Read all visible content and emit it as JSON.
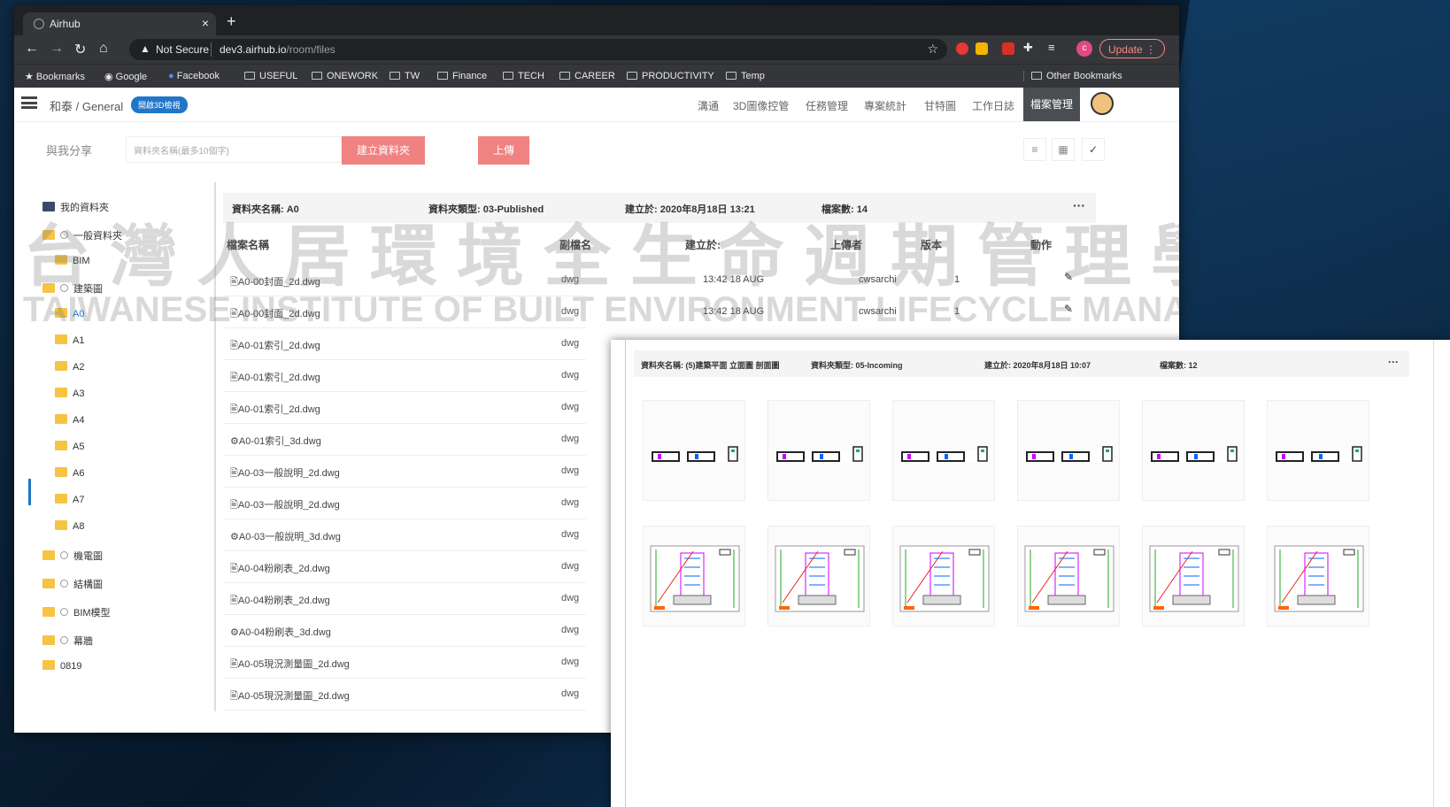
{
  "browser": {
    "tab_title": "Airhub",
    "security": "Not Secure",
    "url_host": "dev3.airhub.io",
    "url_path": "/room/files",
    "update_label": "Update",
    "profile_initial": "c",
    "bookmarks": [
      "Bookmarks",
      "Google",
      "Facebook",
      "USEFUL",
      "ONEWORK",
      "TW",
      "Finance",
      "TECH",
      "CAREER",
      "PRODUCTIVITY",
      "Temp"
    ],
    "other_bookmarks": "Other Bookmarks"
  },
  "app": {
    "breadcrumb": "和泰 / General",
    "pill": "開啟3D檢視",
    "menu": [
      "溝通",
      "3D圖像控管",
      "任務管理",
      "專案統計",
      "甘特圖",
      "工作日誌",
      "檔案管理"
    ],
    "active_menu": "檔案管理"
  },
  "toolbar": {
    "share_label": "與我分享",
    "folder_placeholder": "資料夾名稱(最多10個字)",
    "create_label": "建立資料夾",
    "upload_label": "上傳"
  },
  "tree": {
    "root": "我的資料夾",
    "items": [
      "一般資料夾",
      "BIM",
      "建築圖",
      "A0",
      "A1",
      "A2",
      "A3",
      "A4",
      "A5",
      "A6",
      "A7",
      "A8",
      "機電圖",
      "結構圖",
      "BIM模型",
      "幕牆",
      "0819"
    ]
  },
  "folder": {
    "name": "資料夾名稱: A0",
    "type": "資料夾類型: 03-Published",
    "created": "建立於:  2020年8月18日 13:21",
    "count": "檔案數: 14",
    "more": "···"
  },
  "columns": {
    "name": "檔案名稱",
    "ext": "副檔名",
    "created": "建立於:",
    "uploader": "上傳者",
    "version": "版本",
    "action": "動作"
  },
  "files": [
    {
      "icon": "🖹",
      "name": "A0-00封面_2d.dwg",
      "ext": "dwg",
      "created": "13:42 18 AUG",
      "uploader": "cwsarchi",
      "version": "1"
    },
    {
      "icon": "🖹",
      "name": "A0-00封面_2d.dwg",
      "ext": "dwg",
      "created": "13:42 18 AUG",
      "uploader": "cwsarchi",
      "version": "1"
    },
    {
      "icon": "🖹",
      "name": "A0-01索引_2d.dwg",
      "ext": "dwg"
    },
    {
      "icon": "🖹",
      "name": "A0-01索引_2d.dwg",
      "ext": "dwg"
    },
    {
      "icon": "🖹",
      "name": "A0-01索引_2d.dwg",
      "ext": "dwg"
    },
    {
      "icon": "⚙",
      "name": "A0-01索引_3d.dwg",
      "ext": "dwg"
    },
    {
      "icon": "🖹",
      "name": "A0-03一般說明_2d.dwg",
      "ext": "dwg"
    },
    {
      "icon": "🖹",
      "name": "A0-03一般說明_2d.dwg",
      "ext": "dwg"
    },
    {
      "icon": "⚙",
      "name": "A0-03一般說明_3d.dwg",
      "ext": "dwg"
    },
    {
      "icon": "🖹",
      "name": "A0-04粉刷表_2d.dwg",
      "ext": "dwg"
    },
    {
      "icon": "🖹",
      "name": "A0-04粉刷表_2d.dwg",
      "ext": "dwg"
    },
    {
      "icon": "⚙",
      "name": "A0-04粉刷表_3d.dwg",
      "ext": "dwg"
    },
    {
      "icon": "🖹",
      "name": "A0-05現況測量圖_2d.dwg",
      "ext": "dwg"
    },
    {
      "icon": "🖹",
      "name": "A0-05現況測量圖_2d.dwg",
      "ext": "dwg"
    }
  ],
  "watermark": {
    "zh": "台灣人居環境全生命週期管理學會",
    "en": "TAIWANESE INSTITUTE OF BUILT ENVIRONMENT LIFECYCLE MANAGEMENT"
  },
  "panel2": {
    "name": "資料夾名稱: (5)建築平面 立面圖 剖面圖",
    "type": "資料夾類型: 05-Incoming",
    "created": "建立於:  2020年8月18日 10:07",
    "count": "檔案數: 12",
    "more": "···"
  }
}
